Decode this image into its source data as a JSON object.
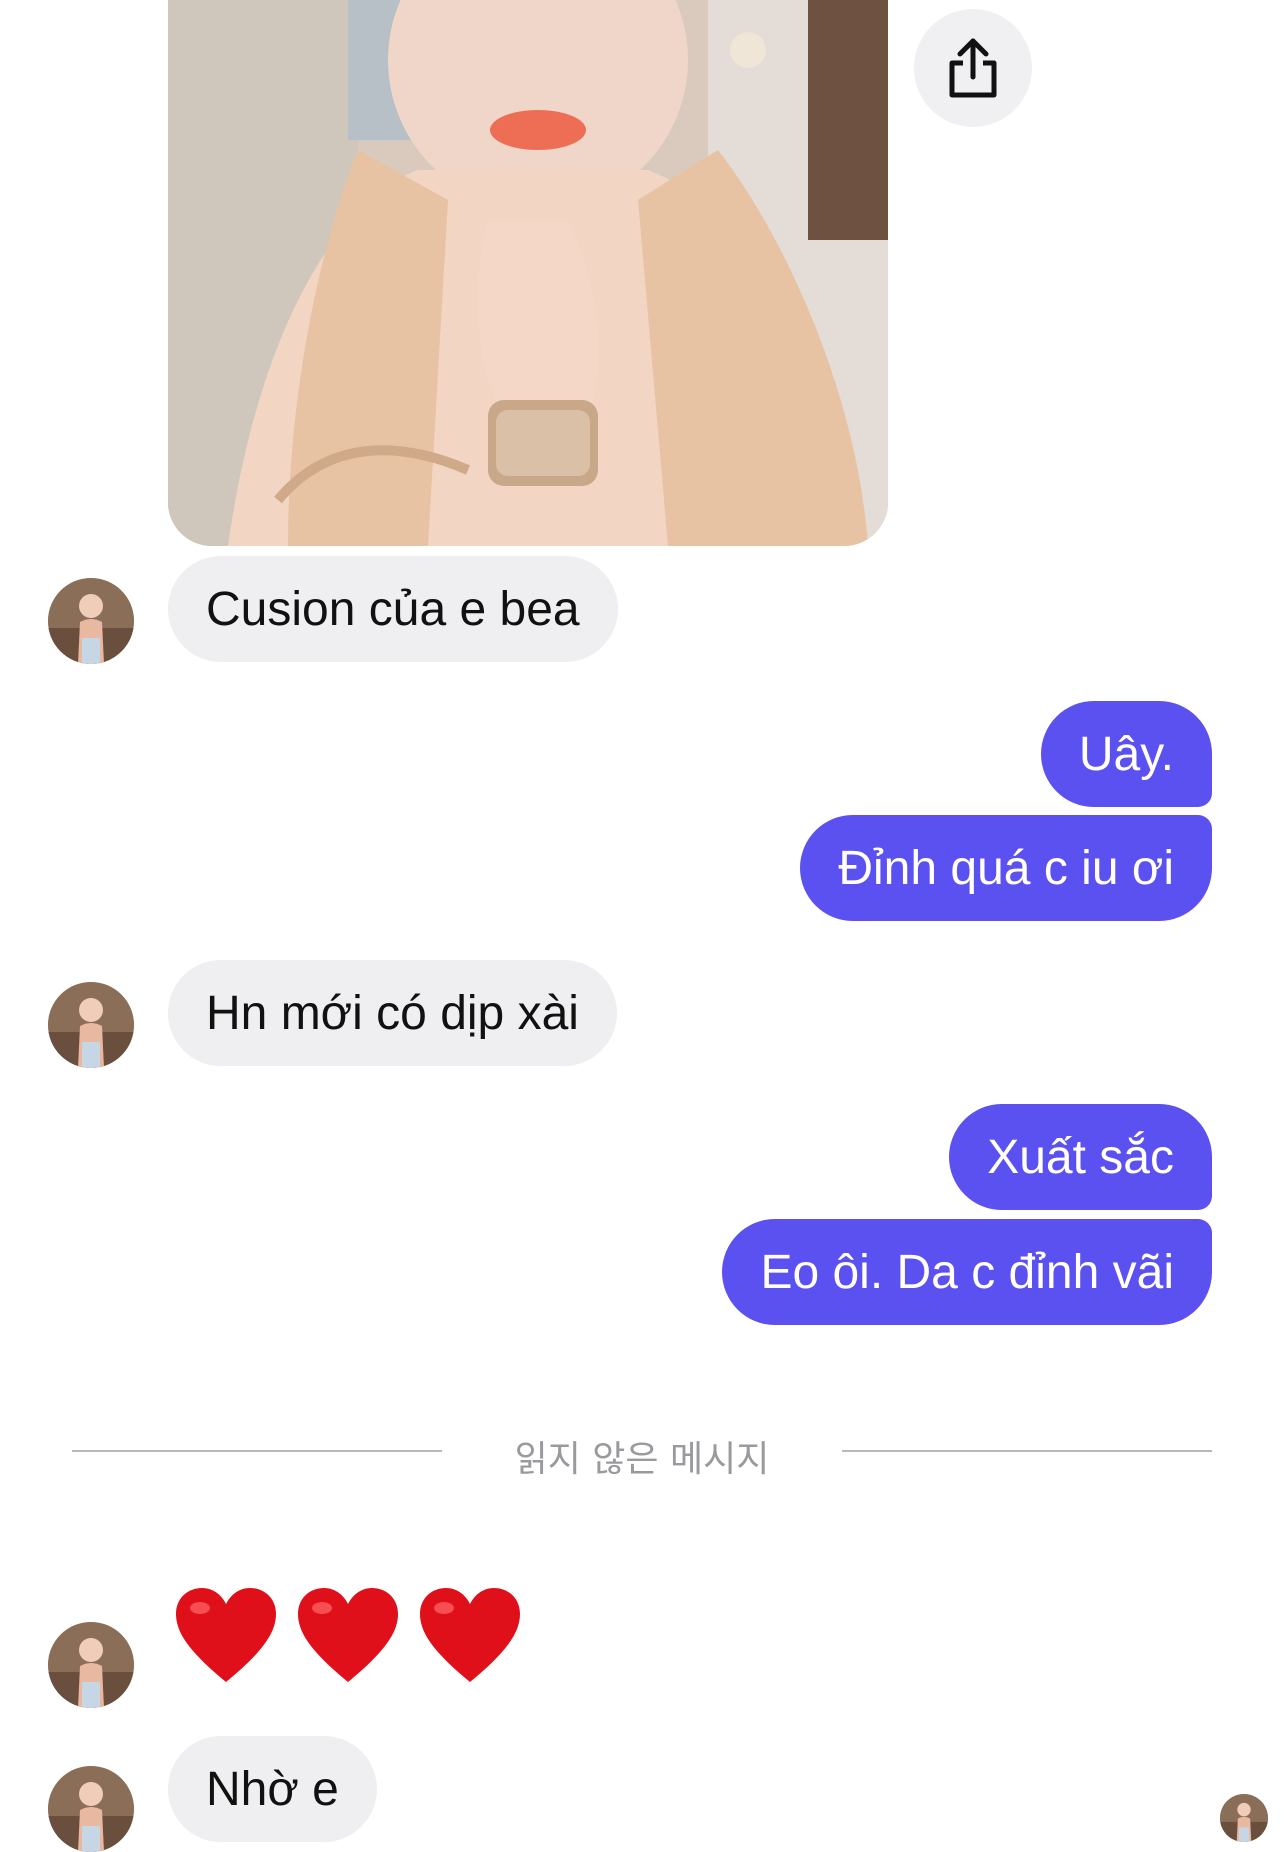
{
  "chat": {
    "messages": [
      {
        "sender": "them",
        "text": "Cusion của e bea"
      },
      {
        "sender": "me",
        "text": "Uây."
      },
      {
        "sender": "me",
        "text": "Đỉnh quá c iu ơi"
      },
      {
        "sender": "them",
        "text": "Hn mới có dịp xài"
      },
      {
        "sender": "me",
        "text": "Xuất sắc"
      },
      {
        "sender": "me",
        "text": "Eo ôi. Da c đỉnh vãi"
      },
      {
        "sender": "them",
        "text": "❤️❤️❤️"
      },
      {
        "sender": "them",
        "text": "Nhờ e"
      }
    ],
    "unread_divider": "읽지 않은 메시지",
    "heart_count": 3
  },
  "icons": {
    "share": "share-icon",
    "heart": "heart-icon"
  },
  "colors": {
    "outgoing_bubble": "#5b50f0",
    "incoming_bubble": "#efeff1",
    "heart": "#e0101a"
  }
}
